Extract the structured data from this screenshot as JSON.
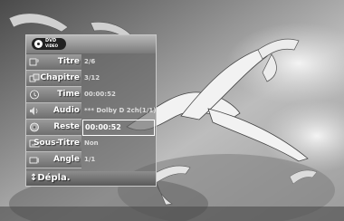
{
  "osd": {
    "logo": {
      "line1": "DVD",
      "line2": "VIDEO"
    },
    "rows": [
      {
        "label": "Titre",
        "value": "2/6",
        "icon": "title-icon"
      },
      {
        "label": "Chapitre",
        "value": "3/12",
        "icon": "chapter-icon"
      },
      {
        "label": "Time",
        "value": "00:00:52",
        "icon": "clock-icon"
      },
      {
        "label": "Audio",
        "value": "*** Dolby D 2ch(1/1)",
        "icon": "speaker-icon"
      },
      {
        "label": "Reste",
        "value": "00:00:52",
        "icon": "disc-icon",
        "selected": true
      },
      {
        "label": "Sous-Titre",
        "value": "Non",
        "icon": "subtitle-icon"
      },
      {
        "label": "Angle",
        "value": "1/1",
        "icon": "camera-icon"
      }
    ],
    "footer": "↕Dépla."
  }
}
